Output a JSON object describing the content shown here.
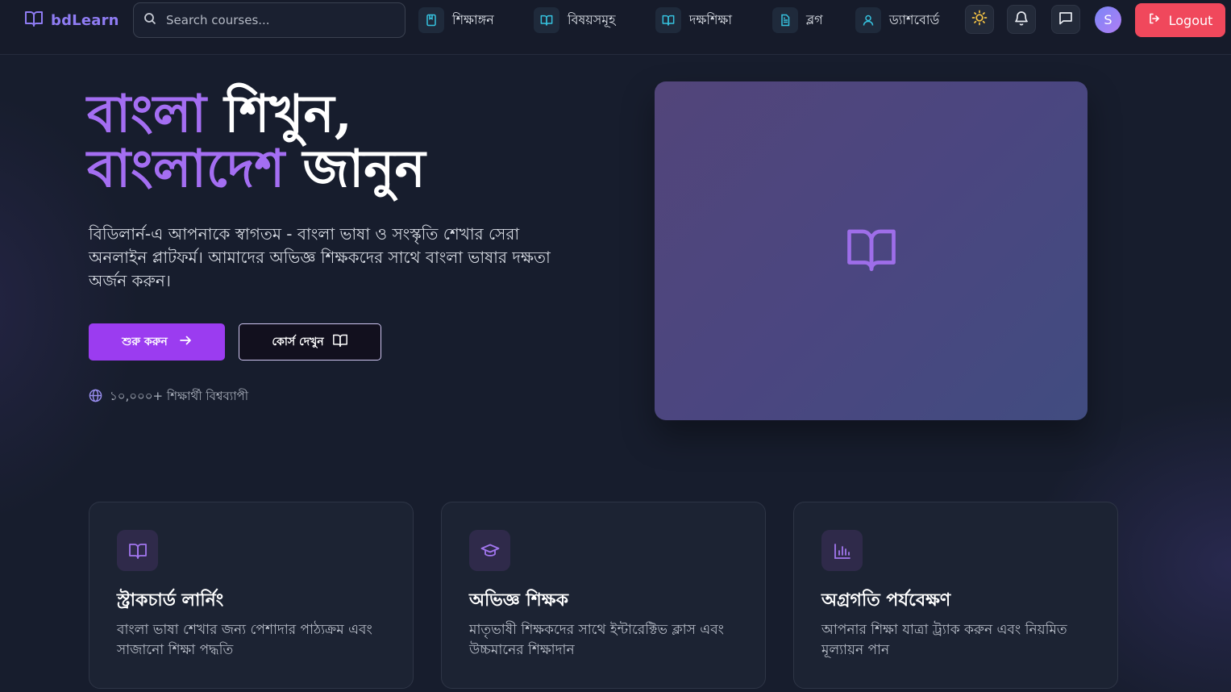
{
  "brand": {
    "name": "bdLearn",
    "accent": "#8f7cf3"
  },
  "search": {
    "placeholder": "Search courses..."
  },
  "nav": {
    "links": [
      {
        "label": "শিক্ষাঙ্গন",
        "icon": "bookmark-book-icon"
      },
      {
        "label": "বিষয়সমূহ",
        "icon": "open-book-icon"
      },
      {
        "label": "দক্ষশিক্ষা",
        "icon": "open-book-icon"
      },
      {
        "label": "ব্লগ",
        "icon": "document-icon"
      },
      {
        "label": "ড্যাশবোর্ড",
        "icon": "user-icon"
      }
    ],
    "avatar_initial": "S",
    "logout_label": "Logout",
    "logout_color": "#f0485c"
  },
  "hero": {
    "title_line1_accent": "বাংলা",
    "title_line1_plain": "শিখুন,",
    "title_line2_accent": "বাংলাদেশ",
    "title_line2_plain": "জানুন",
    "description": "বিডিলার্ন-এ আপনাকে স্বাগতম - বাংলা ভাষা ও সংস্কৃতি শেখার সেরা অনলাইন প্লাটফর্ম। আমাদের অভিজ্ঞ শিক্ষকদের সাথে বাংলা ভাষার দক্ষতা অর্জন করুন।",
    "primary_button": "শুরু করুন",
    "secondary_button": "কোর্স দেখুন",
    "learners_text": "১০,০০০+ শিক্ষার্থী বিশ্বব্যাপী",
    "accent_color": "#a46ef2",
    "button_color": "#9b3cf0"
  },
  "features": [
    {
      "icon": "open-book-icon",
      "title": "স্ট্রাকচার্ড লার্নিং",
      "description": "বাংলা ভাষা শেখার জন্য পেশাদার পাঠ্যক্রম এবং সাজানো শিক্ষা পদ্ধতি"
    },
    {
      "icon": "graduation-cap-icon",
      "title": "অভিজ্ঞ শিক্ষক",
      "description": "মাতৃভাষী শিক্ষকদের সাথে ইন্টারেক্টিভ ক্লাস এবং উচ্চমানের শিক্ষাদান"
    },
    {
      "icon": "bar-chart-icon",
      "title": "অগ্রগতি পর্যবেক্ষণ",
      "description": "আপনার শিক্ষা যাত্রা ট্র্যাক করুন এবং নিয়মিত মূল্যায়ন পান"
    }
  ]
}
